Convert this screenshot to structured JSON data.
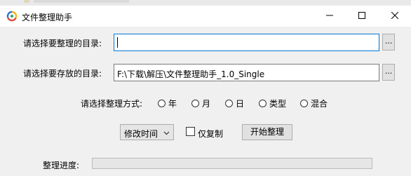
{
  "window": {
    "title": "文件整理助手",
    "controls": [
      "minimize-icon",
      "maximize-icon",
      "close-icon"
    ]
  },
  "source_dir": {
    "label": "请选择要整理的目录:",
    "value": "",
    "browse_label": "..."
  },
  "target_dir": {
    "label": "请选择要存放的目录:",
    "value": "F:\\下载\\解压\\文件整理助手_1.0_Single",
    "browse_label": "..."
  },
  "mode": {
    "label": "请选择整理方式:",
    "options": [
      "年",
      "月",
      "日",
      "类型",
      "混合"
    ],
    "selected": null
  },
  "actions": {
    "time_select": "修改时间",
    "copy_only_label": "仅复制",
    "copy_only_checked": false,
    "start_label": "开始整理"
  },
  "progress": {
    "label": "整理进度:",
    "fraction": 0
  },
  "colors": {
    "accent": "#0078d7",
    "window_bg": "#f0f0f0",
    "progress_fill": "#06b025"
  }
}
